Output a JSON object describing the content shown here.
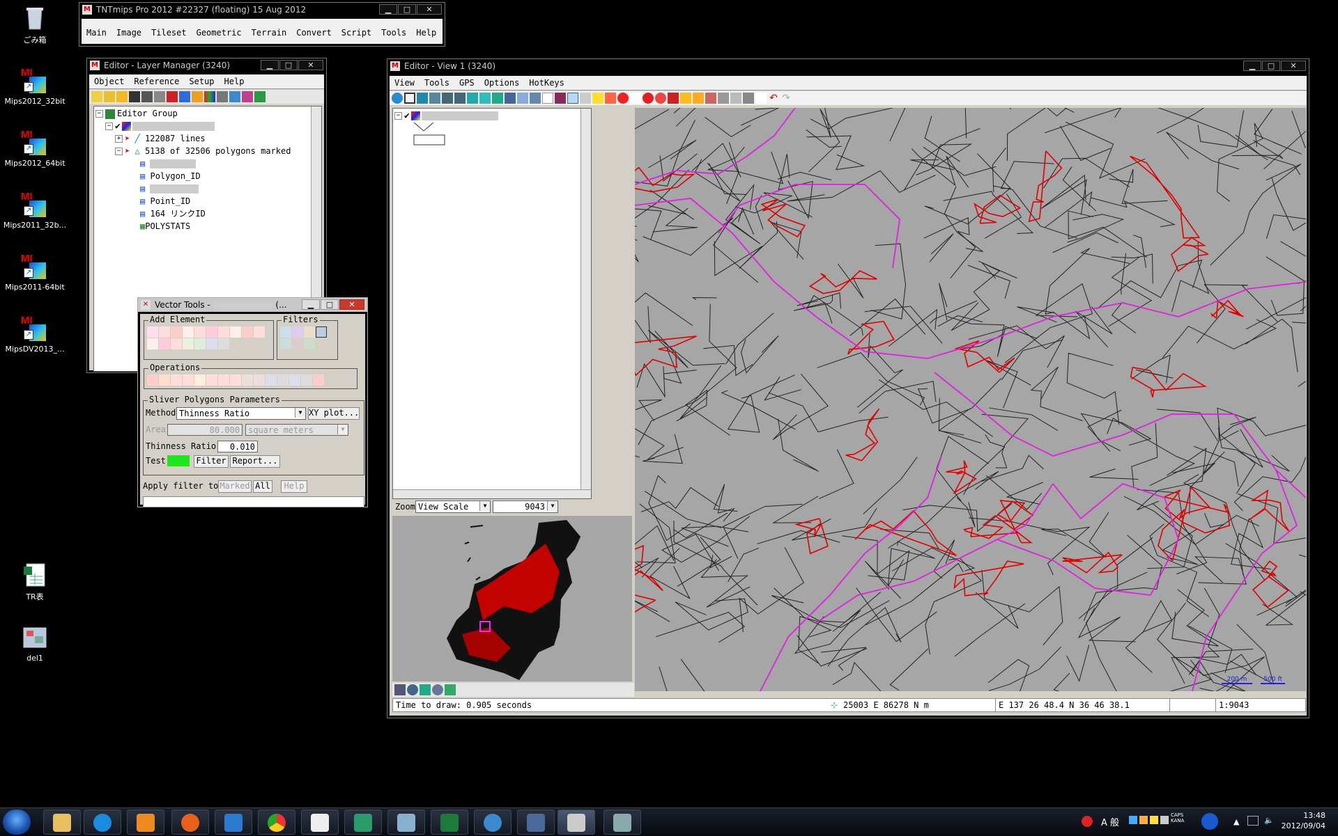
{
  "desktop": {
    "icons": [
      {
        "label": "ごみ箱",
        "icon": "recycle-bin-icon"
      },
      {
        "label": "Mips2012_32bit",
        "icon": "tntmips-shortcut-icon"
      },
      {
        "label": "Mips2012_64bit",
        "icon": "tntmips-shortcut-icon"
      },
      {
        "label": "Mips2011_32b...",
        "icon": "tntmips-shortcut-icon"
      },
      {
        "label": "Mips2011-64bit",
        "icon": "tntmips-shortcut-icon"
      },
      {
        "label": "MipsDV2013_...",
        "icon": "tntmips-shortcut-icon"
      },
      {
        "label": "TR表",
        "icon": "spreadsheet-file-icon"
      },
      {
        "label": "del1",
        "icon": "image-file-icon"
      }
    ]
  },
  "main_window": {
    "title": "TNTmips Pro 2012    #22327 (floating)    15 Aug 2012",
    "menu": [
      "Main",
      "Image",
      "Tileset",
      "Geometric",
      "Terrain",
      "Convert",
      "Script",
      "Tools",
      "Help"
    ]
  },
  "layer_manager": {
    "title": "Editor - Layer Manager (3240)",
    "menu": [
      "Object",
      "Reference",
      "Setup",
      "Help"
    ],
    "tree": {
      "root": "Editor Group",
      "lines": "122087 lines",
      "polygons": "5138 of 32506 polygons marked",
      "tables": [
        "Polygon_ID",
        "Point_ID",
        "164 リンクID",
        "POLYSTATS"
      ]
    }
  },
  "vector_tools": {
    "title": "Vector Tools -",
    "title_suffix": "(...",
    "add_element_label": "Add Element",
    "filters_label": "Filters",
    "operations_label": "Operations",
    "params_label": "Sliver Polygons Parameters",
    "method_label": "Method",
    "method_value": "Thinness Ratio",
    "xy_plot_label": "XY plot...",
    "area_label": "Area",
    "area_value": "80.000",
    "area_units": "square meters",
    "thinness_label": "Thinness Ratio",
    "thinness_value": "0.010",
    "test_label": "Test",
    "filter_label": "Filter",
    "report_label": "Report...",
    "apply_label": "Apply filter to",
    "marked_label": "Marked",
    "all_label": "All",
    "help_label": "Help"
  },
  "view_window": {
    "title": "Editor - View 1 (3240)",
    "menu": [
      "View",
      "Tools",
      "GPS",
      "Options",
      "HotKeys"
    ],
    "zoom_label": "Zoom",
    "zoom_mode": "View Scale",
    "zoom_value": "9043",
    "scale_bar_m": "200 m",
    "scale_bar_ft": "500 ft",
    "status": {
      "time": "Time to draw: 0.905 seconds",
      "coords": "25003 E   86278 N m",
      "latlon": "E 137 26 48.4   N 36 46 38.1",
      "scale": "1:9043"
    },
    "map_colors": {
      "background": "#a6a6a6",
      "lines": "#222222",
      "marked": "#e00000",
      "boundary": "#e020e0"
    }
  },
  "tray": {
    "ime": "A 般",
    "caps": "CAPS",
    "kana": "KANA",
    "time": "13:48",
    "date": "2012/09/04"
  }
}
